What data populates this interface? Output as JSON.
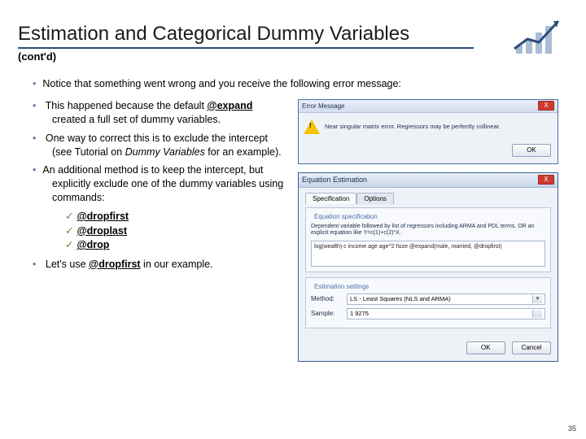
{
  "title": "Estimation and Categorical Dummy Variables",
  "subtitle": "(cont'd)",
  "bullet_top": "Notice that something went wrong and you receive the following error message:",
  "left": {
    "b1_pre": "This happened because the default ",
    "b1_cmd": "@expand",
    "b1_post": " created a full set of dummy variables.",
    "b2_pre": "One way to correct this is to exclude the intercept (see Tutorial on ",
    "b2_it": "Dummy Variables",
    "b2_post": " for an example).",
    "b3": "An additional method is to keep the intercept, but explicitly exclude one of the dummy variables using commands:",
    "cmd1": "@dropfirst",
    "cmd2": "@droplast",
    "cmd3": "@drop",
    "b4_pre": "Let's use ",
    "b4_cmd": "@dropfirst",
    "b4_post": " in our example."
  },
  "err": {
    "title": "Error Message",
    "text": "Near singular matrix error. Regressors may be perfectly collinear.",
    "ok": "OK"
  },
  "eq": {
    "title": "Equation Estimation",
    "tab1": "Specification",
    "tab2": "Options",
    "group1": "Equation specification",
    "hint": "Dependent variable followed by list of regressors including ARMA and PDL terms, OR an explicit equation like Y=c(1)+c(2)*X.",
    "specbox": "log(wealth) c income age age^2 fsize @expand(male, married, @dropfirst)",
    "group2": "Estimation settings",
    "method_lbl": "Method:",
    "method_val": "LS - Least Squares (NLS and ARMA)",
    "sample_lbl": "Sample:",
    "sample_val": "1  9275",
    "ok": "OK",
    "cancel": "Cancel"
  },
  "pagenum": "35"
}
